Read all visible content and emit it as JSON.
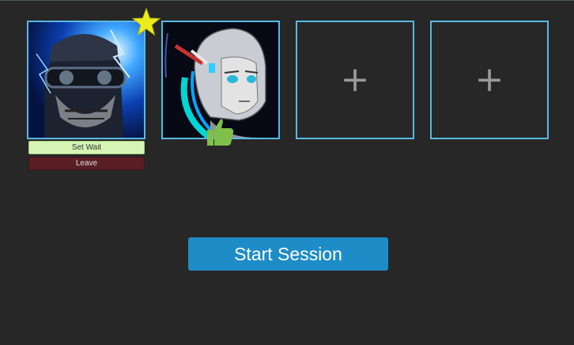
{
  "lobby": {
    "slots": [
      {
        "state": "occupied",
        "host": true,
        "portrait": "soldier-portrait"
      },
      {
        "state": "occupied",
        "ready": true,
        "portrait": "android-portrait"
      },
      {
        "state": "empty",
        "icon": "plus-icon",
        "glyph": "+"
      },
      {
        "state": "empty",
        "icon": "plus-icon",
        "glyph": "+"
      }
    ],
    "set_wait_label": "Set Wait",
    "leave_label": "Leave",
    "start_label": "Start Session"
  },
  "colors": {
    "background": "#272727",
    "slot_border": "#58b8e6",
    "set_wait_bg": "#d6f5b4",
    "leave_bg": "#5a1f24",
    "start_bg": "#1e8cc6",
    "star": "#ecec1a",
    "thumb": "#7fbf4a"
  }
}
